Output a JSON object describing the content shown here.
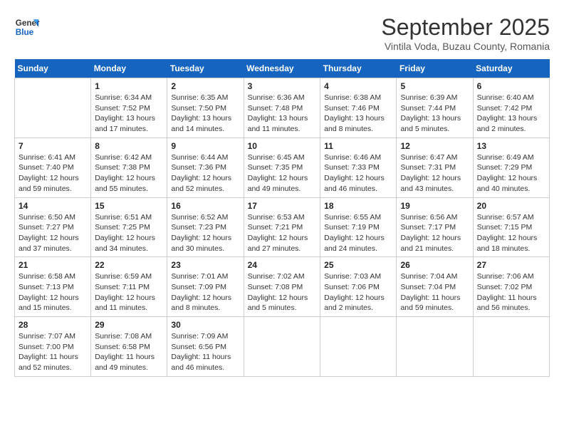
{
  "header": {
    "logo_line1": "General",
    "logo_line2": "Blue",
    "month": "September 2025",
    "location": "Vintila Voda, Buzau County, Romania"
  },
  "weekdays": [
    "Sunday",
    "Monday",
    "Tuesday",
    "Wednesday",
    "Thursday",
    "Friday",
    "Saturday"
  ],
  "weeks": [
    [
      {
        "day": "",
        "info": ""
      },
      {
        "day": "1",
        "info": "Sunrise: 6:34 AM\nSunset: 7:52 PM\nDaylight: 13 hours\nand 17 minutes."
      },
      {
        "day": "2",
        "info": "Sunrise: 6:35 AM\nSunset: 7:50 PM\nDaylight: 13 hours\nand 14 minutes."
      },
      {
        "day": "3",
        "info": "Sunrise: 6:36 AM\nSunset: 7:48 PM\nDaylight: 13 hours\nand 11 minutes."
      },
      {
        "day": "4",
        "info": "Sunrise: 6:38 AM\nSunset: 7:46 PM\nDaylight: 13 hours\nand 8 minutes."
      },
      {
        "day": "5",
        "info": "Sunrise: 6:39 AM\nSunset: 7:44 PM\nDaylight: 13 hours\nand 5 minutes."
      },
      {
        "day": "6",
        "info": "Sunrise: 6:40 AM\nSunset: 7:42 PM\nDaylight: 13 hours\nand 2 minutes."
      }
    ],
    [
      {
        "day": "7",
        "info": "Sunrise: 6:41 AM\nSunset: 7:40 PM\nDaylight: 12 hours\nand 59 minutes."
      },
      {
        "day": "8",
        "info": "Sunrise: 6:42 AM\nSunset: 7:38 PM\nDaylight: 12 hours\nand 55 minutes."
      },
      {
        "day": "9",
        "info": "Sunrise: 6:44 AM\nSunset: 7:36 PM\nDaylight: 12 hours\nand 52 minutes."
      },
      {
        "day": "10",
        "info": "Sunrise: 6:45 AM\nSunset: 7:35 PM\nDaylight: 12 hours\nand 49 minutes."
      },
      {
        "day": "11",
        "info": "Sunrise: 6:46 AM\nSunset: 7:33 PM\nDaylight: 12 hours\nand 46 minutes."
      },
      {
        "day": "12",
        "info": "Sunrise: 6:47 AM\nSunset: 7:31 PM\nDaylight: 12 hours\nand 43 minutes."
      },
      {
        "day": "13",
        "info": "Sunrise: 6:49 AM\nSunset: 7:29 PM\nDaylight: 12 hours\nand 40 minutes."
      }
    ],
    [
      {
        "day": "14",
        "info": "Sunrise: 6:50 AM\nSunset: 7:27 PM\nDaylight: 12 hours\nand 37 minutes."
      },
      {
        "day": "15",
        "info": "Sunrise: 6:51 AM\nSunset: 7:25 PM\nDaylight: 12 hours\nand 34 minutes."
      },
      {
        "day": "16",
        "info": "Sunrise: 6:52 AM\nSunset: 7:23 PM\nDaylight: 12 hours\nand 30 minutes."
      },
      {
        "day": "17",
        "info": "Sunrise: 6:53 AM\nSunset: 7:21 PM\nDaylight: 12 hours\nand 27 minutes."
      },
      {
        "day": "18",
        "info": "Sunrise: 6:55 AM\nSunset: 7:19 PM\nDaylight: 12 hours\nand 24 minutes."
      },
      {
        "day": "19",
        "info": "Sunrise: 6:56 AM\nSunset: 7:17 PM\nDaylight: 12 hours\nand 21 minutes."
      },
      {
        "day": "20",
        "info": "Sunrise: 6:57 AM\nSunset: 7:15 PM\nDaylight: 12 hours\nand 18 minutes."
      }
    ],
    [
      {
        "day": "21",
        "info": "Sunrise: 6:58 AM\nSunset: 7:13 PM\nDaylight: 12 hours\nand 15 minutes."
      },
      {
        "day": "22",
        "info": "Sunrise: 6:59 AM\nSunset: 7:11 PM\nDaylight: 12 hours\nand 11 minutes."
      },
      {
        "day": "23",
        "info": "Sunrise: 7:01 AM\nSunset: 7:09 PM\nDaylight: 12 hours\nand 8 minutes."
      },
      {
        "day": "24",
        "info": "Sunrise: 7:02 AM\nSunset: 7:08 PM\nDaylight: 12 hours\nand 5 minutes."
      },
      {
        "day": "25",
        "info": "Sunrise: 7:03 AM\nSunset: 7:06 PM\nDaylight: 12 hours\nand 2 minutes."
      },
      {
        "day": "26",
        "info": "Sunrise: 7:04 AM\nSunset: 7:04 PM\nDaylight: 11 hours\nand 59 minutes."
      },
      {
        "day": "27",
        "info": "Sunrise: 7:06 AM\nSunset: 7:02 PM\nDaylight: 11 hours\nand 56 minutes."
      }
    ],
    [
      {
        "day": "28",
        "info": "Sunrise: 7:07 AM\nSunset: 7:00 PM\nDaylight: 11 hours\nand 52 minutes."
      },
      {
        "day": "29",
        "info": "Sunrise: 7:08 AM\nSunset: 6:58 PM\nDaylight: 11 hours\nand 49 minutes."
      },
      {
        "day": "30",
        "info": "Sunrise: 7:09 AM\nSunset: 6:56 PM\nDaylight: 11 hours\nand 46 minutes."
      },
      {
        "day": "",
        "info": ""
      },
      {
        "day": "",
        "info": ""
      },
      {
        "day": "",
        "info": ""
      },
      {
        "day": "",
        "info": ""
      }
    ]
  ]
}
